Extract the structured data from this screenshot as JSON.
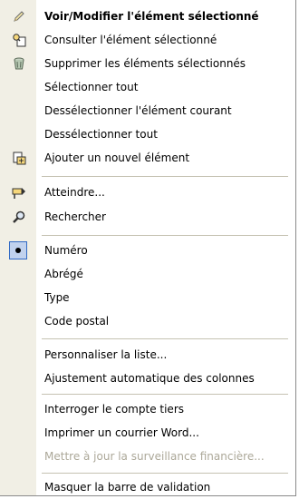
{
  "menu": {
    "items": [
      {
        "label": "Voir/Modifier l'élément sélectionné",
        "icon": "pencil-icon"
      },
      {
        "label": "Consulter l'élément sélectionné",
        "icon": "view-item-icon"
      },
      {
        "label": "Supprimer les éléments sélectionnés",
        "icon": "trash-icon"
      },
      {
        "label": "Sélectionner tout"
      },
      {
        "label": "Dessélectionner l'élément courant"
      },
      {
        "label": "Dessélectionner tout"
      },
      {
        "label": "Ajouter un nouvel élément",
        "icon": "add-item-icon"
      },
      {
        "label": "Atteindre...",
        "icon": "goto-icon"
      },
      {
        "label": "Rechercher",
        "icon": "search-icon"
      },
      {
        "label": "Numéro",
        "selected": true
      },
      {
        "label": "Abrégé"
      },
      {
        "label": "Type"
      },
      {
        "label": "Code postal"
      },
      {
        "label": "Personnaliser la liste..."
      },
      {
        "label": "Ajustement automatique des colonnes"
      },
      {
        "label": "Interroger le compte tiers"
      },
      {
        "label": "Imprimer un courrier Word..."
      },
      {
        "label": "Mettre à jour la surveillance financière...",
        "disabled": true
      },
      {
        "label": "Masquer la barre de validation"
      }
    ]
  },
  "colors": {
    "gutter": "#f1efe5",
    "disabled_text": "#aca899",
    "selection_fill": "#c1d2ee",
    "selection_border": "#316ac5"
  }
}
